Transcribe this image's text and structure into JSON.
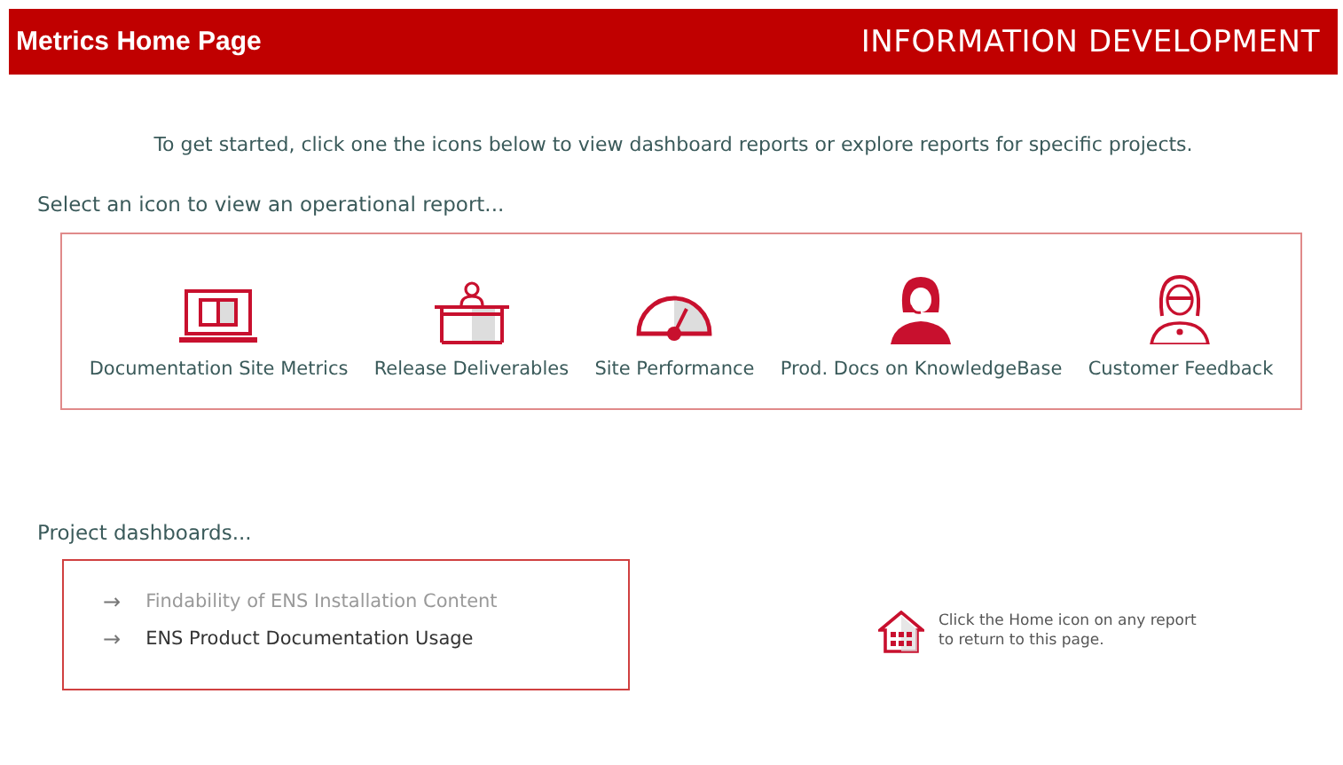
{
  "header": {
    "title": "Metrics Home Page",
    "section": "INFORMATION DEVELOPMENT"
  },
  "intro": "To get started, click one the icons below to view dashboard reports or explore reports for specific projects.",
  "reports_heading": "Select an icon to view an operational report...",
  "reports": [
    {
      "kind": "laptop",
      "label": "Documentation Site Metrics"
    },
    {
      "kind": "desk",
      "label": "Release Deliverables"
    },
    {
      "kind": "gauge",
      "label": "Site Performance"
    },
    {
      "kind": "headset",
      "label": "Prod. Docs on KnowledgeBase"
    },
    {
      "kind": "person",
      "label": "Customer Feedback"
    }
  ],
  "projects_heading": "Project dashboards...",
  "projects": [
    {
      "arrow": "→",
      "label": "Findability of ENS Installation Content",
      "dimmed": true
    },
    {
      "arrow": "→",
      "label": "ENS Product Documentation Usage",
      "dimmed": false
    }
  ],
  "home_hint": "Click the Home icon on any report to return to this page."
}
